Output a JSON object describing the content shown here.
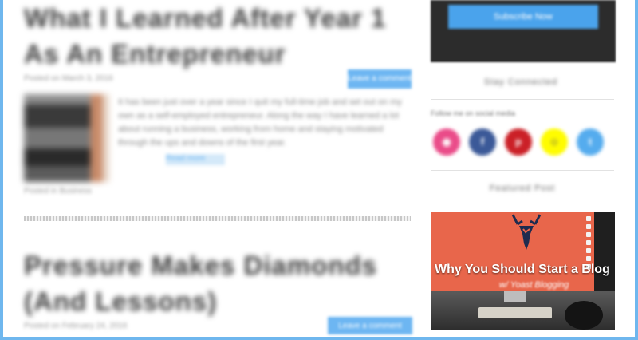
{
  "posts": [
    {
      "title": "What I Learned After Year 1 As An Entrepreneur",
      "meta": "Posted on March 3, 2016",
      "button_label": "Leave a comment",
      "excerpt": "It has been just over a year since I quit my full-time job and set out on my own as a self-employed entrepreneur. Along the way I have learned a lot about running a business, working from home and staying motivated through the ups and downs of the first year.",
      "read_more": "Read more",
      "thumb_caption": "Posted in Business"
    },
    {
      "title": "Pressure Makes Diamonds (And Lessons)",
      "meta": "Posted on February 24, 2016",
      "button_label": "Leave a comment"
    }
  ],
  "sidebar": {
    "subscribe_button": "Subscribe Now",
    "connect_heading": "Stay Connected",
    "follow_text": "Follow me on social media",
    "social": [
      {
        "icon": "dribbble-icon",
        "glyph": "◉",
        "color": "#ea4c89"
      },
      {
        "icon": "facebook-icon",
        "glyph": "f",
        "color": "#3b5998"
      },
      {
        "icon": "pinterest-icon",
        "glyph": "p",
        "color": "#cb2027"
      },
      {
        "icon": "snapchat-icon",
        "glyph": "☺",
        "color": "#fffc00"
      },
      {
        "icon": "twitter-icon",
        "glyph": "t",
        "color": "#55acee"
      }
    ],
    "featured_heading": "Featured Post",
    "promo_title": "Why You Should Start a Blog",
    "promo_subtitle": "w/ Yoast Blogging"
  },
  "colors": {
    "accent_blue": "#6db6f2",
    "frame_blue": "#6fb7ee",
    "promo_orange": "#e8664b"
  }
}
